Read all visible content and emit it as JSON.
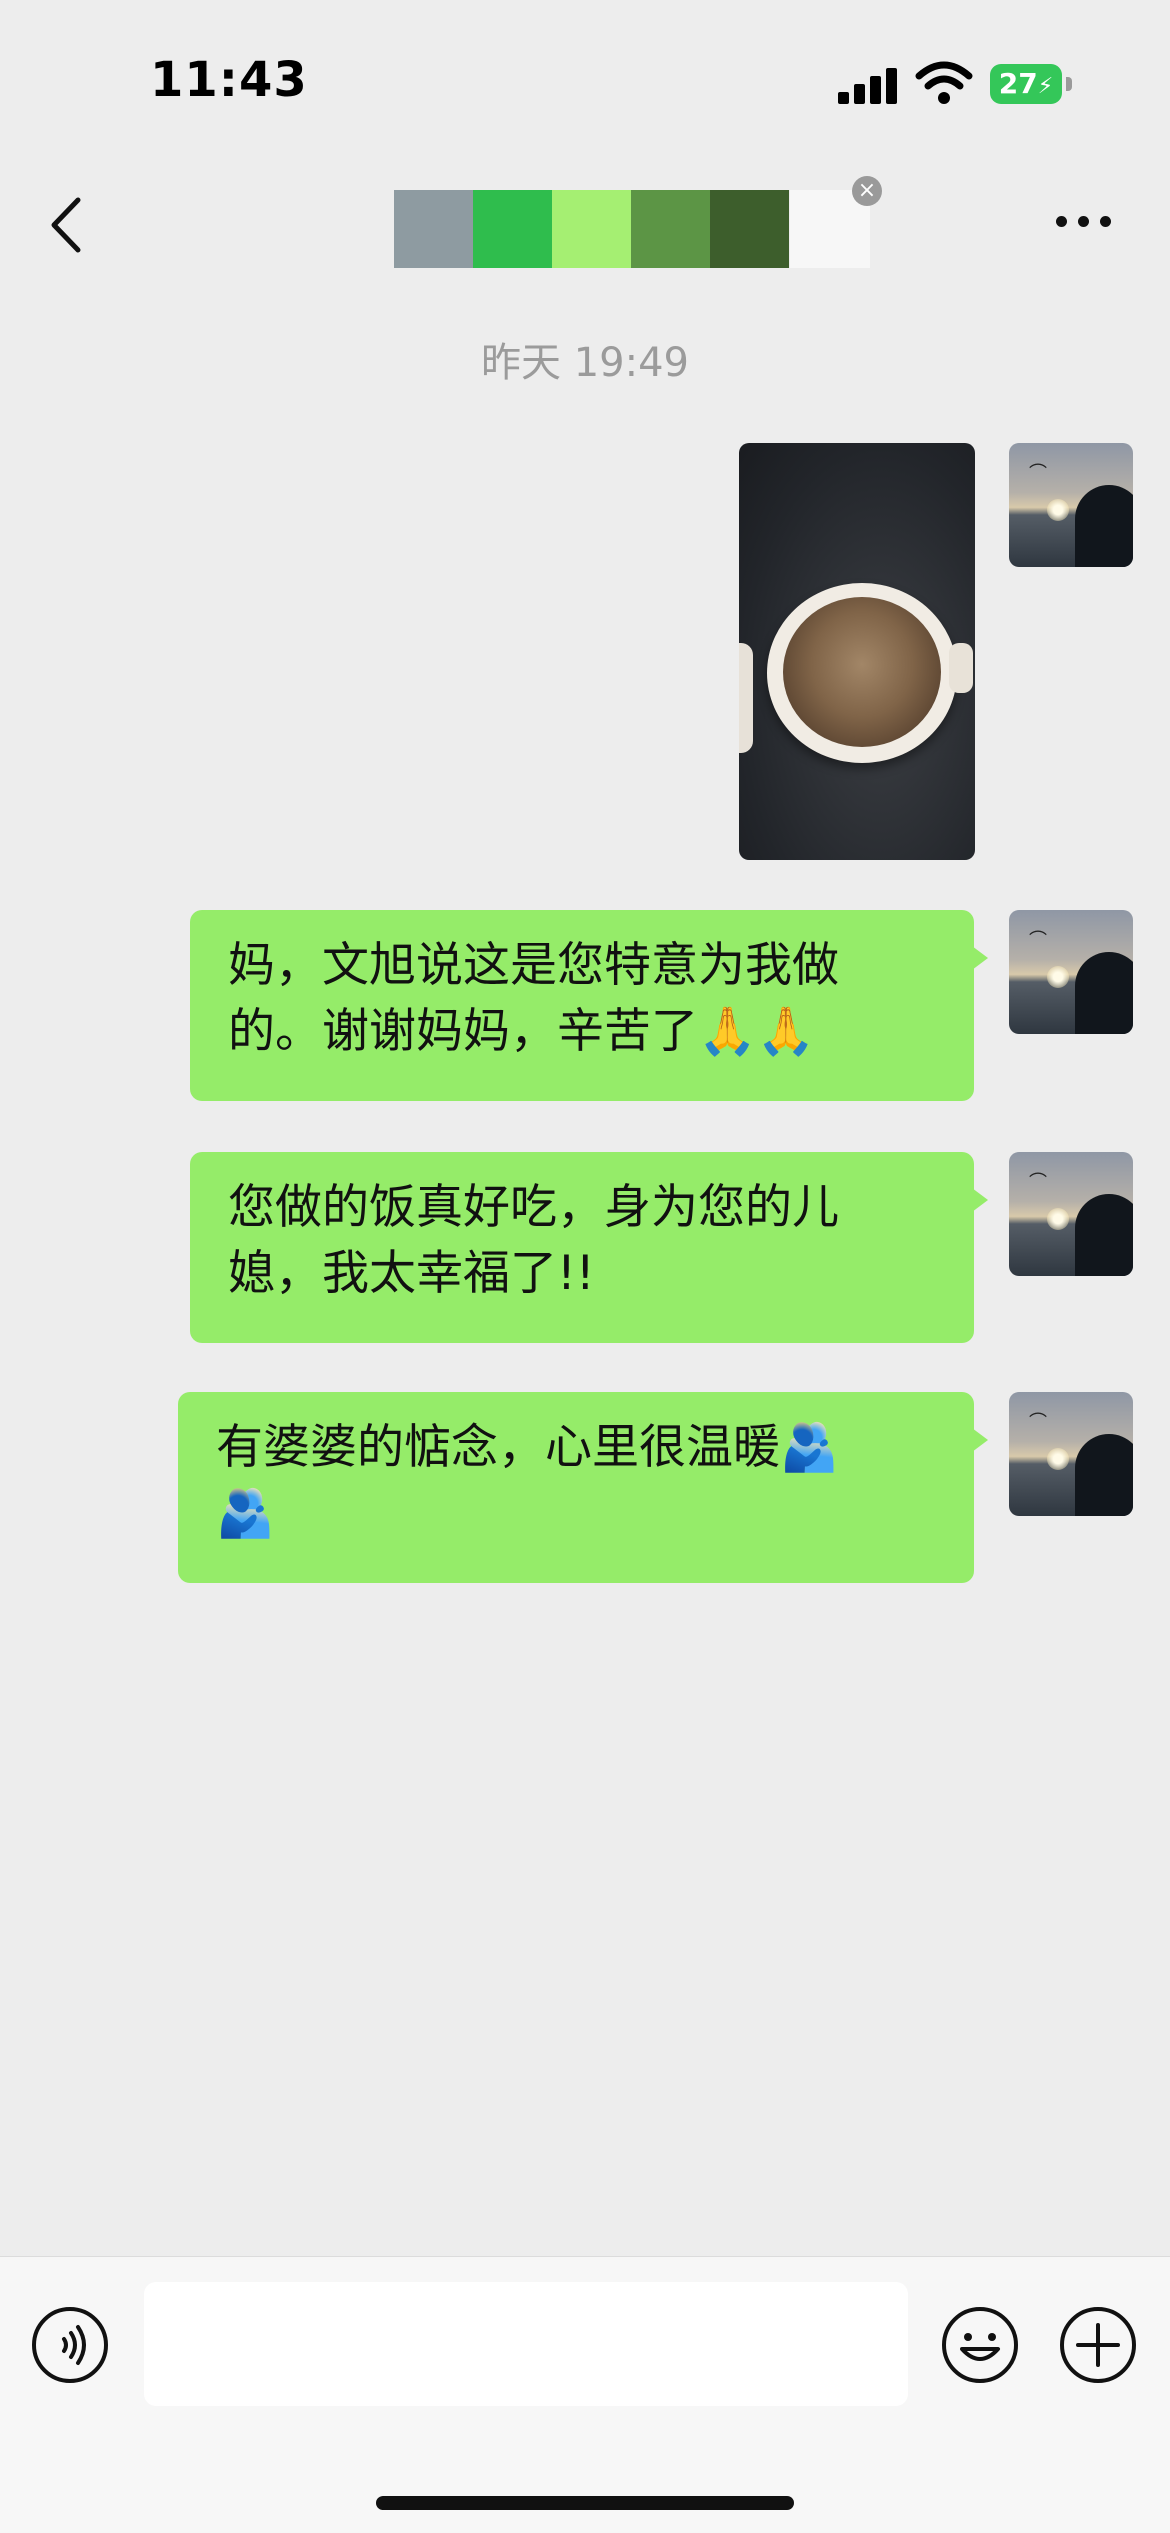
{
  "status_bar": {
    "time": "11:43",
    "battery": "27"
  },
  "nav": {
    "title_colors": [
      "#8e9ba1",
      "#2fbd4d",
      "#a5ef72",
      "#5c9545",
      "#3d5e2c"
    ]
  },
  "timestamp": "昨天 19:49",
  "messages": [
    {
      "type": "image",
      "description": "photo"
    },
    {
      "type": "text",
      "lines": [
        "妈，文旭说这是您特意为我做",
        "的。谢谢妈妈，辛苦了🙏🙏"
      ]
    },
    {
      "type": "text",
      "lines": [
        "您做的饭真好吃，身为您的儿",
        "媳，我太幸福了!!"
      ]
    },
    {
      "type": "text",
      "lines": [
        "有婆婆的惦念，心里很温暖🫂",
        "🫂"
      ]
    }
  ],
  "colors": {
    "bubble": "#95ec69",
    "background": "#ededed"
  },
  "icons": {
    "back": "chevron-left-icon",
    "more": "more-dots-icon",
    "voice": "voice-icon",
    "emoji": "emoji-icon",
    "plus": "plus-icon"
  }
}
